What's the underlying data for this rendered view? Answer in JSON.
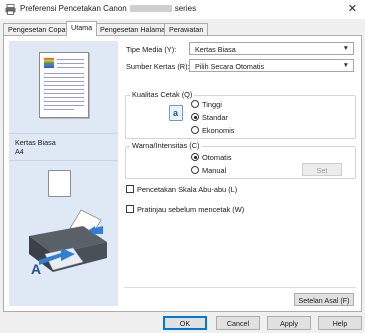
{
  "window": {
    "title_prefix": "Preferensi Pencetakan Canon",
    "title_suffix": "series",
    "close_glyph": "✕"
  },
  "tabs": [
    {
      "label": "Pengesetan Copat",
      "active": false
    },
    {
      "label": "Utama",
      "active": true
    },
    {
      "label": "Pengesetan Halaman",
      "active": false
    },
    {
      "label": "Perawatan",
      "active": false
    }
  ],
  "preview": {
    "paper_name": "Kertas Biasa",
    "paper_size": "A4"
  },
  "media": {
    "label": "Tipe Media (Y):",
    "value": "Kertas Biasa"
  },
  "source": {
    "label": "Sumber Kertas (R):",
    "value": "Pilih Secara Otomatis"
  },
  "quality": {
    "title": "Kualitas Cetak (Q)",
    "options": [
      "Tinggi",
      "Standar",
      "Ekonomis"
    ],
    "selected": "Standar",
    "icon_glyph": "a"
  },
  "color": {
    "title": "Warna/Intensitas (C)",
    "options": [
      "Otomatis",
      "Manual"
    ],
    "selected": "Otomatis",
    "set_label": "Set"
  },
  "grayscale": {
    "label": "Pencetakan Skala Abu-abu (L)",
    "checked": false
  },
  "preview_before_print": {
    "label": "Pratinjau sebelum mencetak (W)",
    "checked": false
  },
  "defaults_label": "Setelan Asal (F)",
  "footer": {
    "ok": "OK",
    "cancel": "Cancel",
    "apply": "Apply",
    "help": "Help"
  },
  "colors": {
    "accent": "#0078d7",
    "left_panel": "#dfe9f6",
    "icon_blue": "#1f4e9c"
  },
  "icons": [
    "printer-app-icon",
    "close-icon",
    "chevron-down-icon",
    "print-quality-icon",
    "paper-icon",
    "printer-illustration"
  ]
}
